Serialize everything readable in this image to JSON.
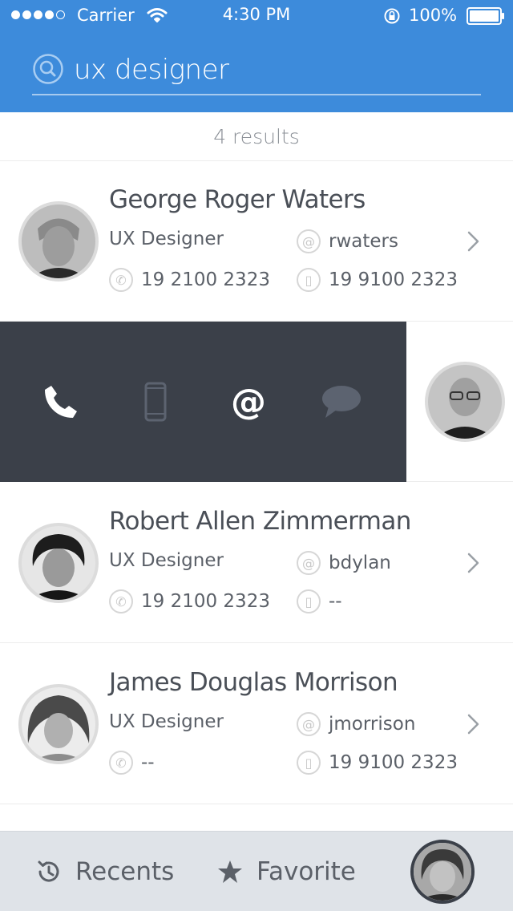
{
  "status_bar": {
    "carrier": "Carrier",
    "time": "4:30 PM",
    "battery": "100%"
  },
  "search": {
    "value": "ux designer",
    "icon": "search-icon"
  },
  "results": {
    "count_label": "4 results"
  },
  "contacts": [
    {
      "name": "George Roger Waters",
      "role": "UX Designer",
      "username": "rwaters",
      "phone": "19 2100 2323",
      "mobile": "19 9100 2323"
    },
    {
      "name": "Robert Allen Zimmerman",
      "role": "UX Designer",
      "username": "bdylan",
      "phone": "19 2100 2323",
      "mobile": "--"
    },
    {
      "name": "James Douglas Morrison",
      "role": "UX Designer",
      "username": "jmorrison",
      "phone": "--",
      "mobile": "19 9100 2323"
    }
  ],
  "swipe_actions": [
    "phone-icon",
    "mobile-icon",
    "at-icon",
    "message-icon"
  ],
  "tabbar": {
    "recents": "Recents",
    "favorite": "Favorite"
  },
  "colors": {
    "header": "#3d8bdb",
    "action_panel": "#3b4049",
    "tabbar": "#dfe3e8"
  }
}
